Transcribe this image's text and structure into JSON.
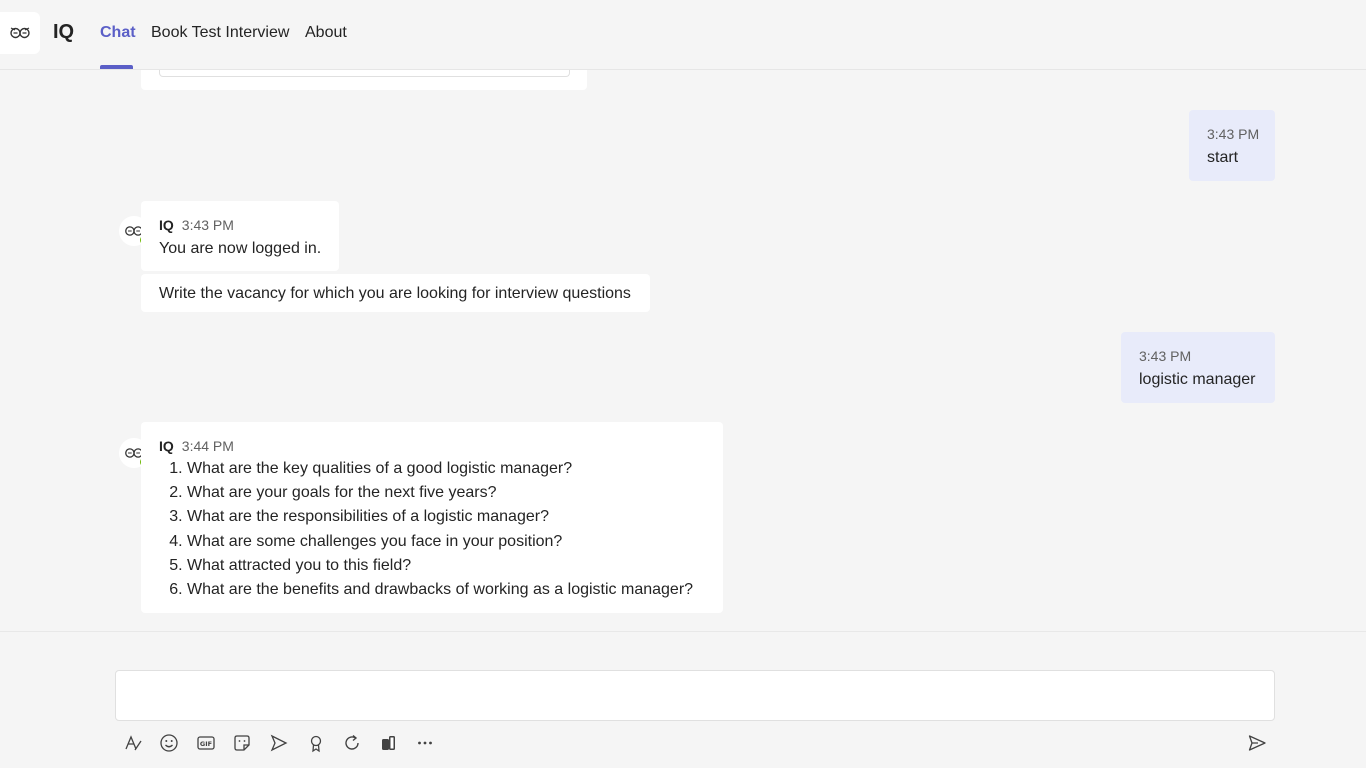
{
  "app": {
    "name": "IQ"
  },
  "tabs": [
    {
      "label": "Chat",
      "active": true
    },
    {
      "label": "Book Test Interview",
      "active": false
    },
    {
      "label": "About",
      "active": false
    }
  ],
  "messages": {
    "user_start": {
      "time": "3:43 PM",
      "text": "start"
    },
    "bot_login": {
      "sender": "IQ",
      "time": "3:43 PM",
      "text": "You are now logged in."
    },
    "bot_prompt": {
      "text": "Write the vacancy for which you are looking for interview questions"
    },
    "user_vacancy": {
      "time": "3:43 PM",
      "text": "logistic manager"
    },
    "bot_questions": {
      "sender": "IQ",
      "time": "3:44 PM",
      "items": [
        "What are the key qualities of a good logistic manager?",
        "What are your goals for the next five years?",
        "What are the responsibilities of a logistic manager?",
        "What are some challenges you face in your position?",
        "What attracted you to this field?",
        "What are the benefits and drawbacks of working as a logistic manager?"
      ]
    }
  },
  "toolbar": {
    "icons": [
      "format-icon",
      "emoji-icon",
      "gif-icon",
      "sticker-icon",
      "schedule-icon",
      "praise-icon",
      "loop-icon",
      "apps-icon",
      "more-icon",
      "send-icon"
    ]
  },
  "colors": {
    "accent": "#5b5fc7",
    "outgoing_bubble": "#e8ebfa",
    "presence": "#6bb700"
  }
}
